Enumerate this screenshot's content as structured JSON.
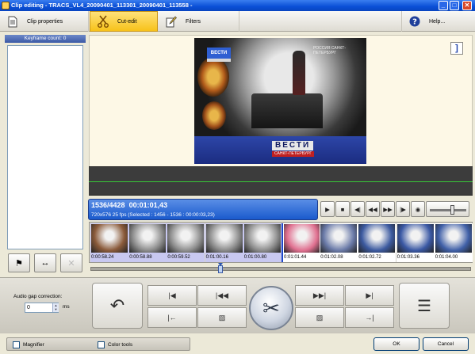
{
  "window": {
    "title": "Clip editing - TRACS_VL4_20090401_113301_20090401_113558 -",
    "buttons": {
      "minimize": "_",
      "maximize": "□",
      "close": "✕"
    }
  },
  "toolbar": {
    "tabs": [
      {
        "label": "Clip properties",
        "icon": "document-icon",
        "active": false
      },
      {
        "label": "Cut-edit",
        "icon": "scissors-icon",
        "active": true
      },
      {
        "label": "Filters",
        "icon": "filter-pencil-icon",
        "active": false
      }
    ],
    "help": {
      "label": "Help...",
      "icon": "help-icon"
    }
  },
  "keyframes": {
    "header": "Keyframe count: 0",
    "buttons": {
      "flag": "⚑",
      "spread": "↔",
      "delete": "✕"
    }
  },
  "preview": {
    "logo_text": "ВЕСТИ",
    "corner_text": "РОССИЯ САНКТ-ПЕТЕРБУРГ",
    "banner_text": "ВЕСТИ",
    "city_text": "САНКТ-ПЕТЕРБУРГ",
    "fit_button": "]"
  },
  "position": {
    "frame": "1536/4428",
    "time": "00:01:01,43",
    "format_info": "720x576 25 fps (Selected : 1456 - 1536 : 00:00:03,23)"
  },
  "transport": {
    "buttons": [
      {
        "name": "play-button",
        "glyph": "▶"
      },
      {
        "name": "stop-button",
        "glyph": "■"
      },
      {
        "name": "prev-frame-button",
        "glyph": "◀|"
      },
      {
        "name": "rewind-button",
        "glyph": "◀◀"
      },
      {
        "name": "fast-forward-button",
        "glyph": "▶▶"
      },
      {
        "name": "next-frame-button",
        "glyph": "|▶"
      },
      {
        "name": "speaker-button",
        "glyph": "◉"
      }
    ],
    "volume_level": 0.62
  },
  "filmstrip": {
    "frames": [
      {
        "time": "0:00:58.24",
        "selected": true,
        "color": "#8a5a3a"
      },
      {
        "time": "0:00:58.88",
        "selected": true,
        "color": "#8c8c8c"
      },
      {
        "time": "0:00:59.52",
        "selected": true,
        "color": "#8f8f8f"
      },
      {
        "time": "0:01:00.16",
        "selected": true,
        "color": "#8a8a8a"
      },
      {
        "time": "0:01:00.80",
        "selected": true,
        "color": "#8d8d8d"
      },
      {
        "time": "0:01:01.44",
        "selected": false,
        "current": true,
        "color": "#e07090"
      },
      {
        "time": "0:01:02.08",
        "selected": false,
        "color": "#6a7aa8"
      },
      {
        "time": "0:01:02.72",
        "selected": false,
        "color": "#3c5aa0"
      },
      {
        "time": "0:01:03.36",
        "selected": false,
        "color": "#3a58a4"
      },
      {
        "time": "0:01:04.00",
        "selected": false,
        "color": "#4060a8"
      }
    ],
    "scroll_position": 0.34
  },
  "controls": {
    "gap_label": "Audio gap correction:",
    "gap_value": "0",
    "gap_unit": "ms",
    "undo_glyph": "↶",
    "list_glyph": "☰",
    "cut_glyph": "✂",
    "mark_buttons": [
      {
        "name": "mark-in-left-button",
        "glyph": "|◀"
      },
      {
        "name": "go-mark-in-button",
        "glyph": "|◀◀"
      },
      {
        "name": "go-mark-out-button",
        "glyph": "▶▶|"
      },
      {
        "name": "mark-out-right-button",
        "glyph": "▶|"
      },
      {
        "name": "set-in-button",
        "glyph": "|←"
      },
      {
        "name": "select-in-range-button",
        "glyph": "▨"
      },
      {
        "name": "select-out-range-button",
        "glyph": "▨"
      },
      {
        "name": "set-out-button",
        "glyph": "→|"
      }
    ]
  },
  "footer": {
    "magnifier_label": "Magnifier",
    "color_tools_label": "Color tools",
    "ok_label": "OK",
    "cancel_label": "Cancel"
  },
  "colors": {
    "accent": "#f7c21a",
    "selection": "#c8c8f0",
    "current_frame": "#1e48c8"
  }
}
